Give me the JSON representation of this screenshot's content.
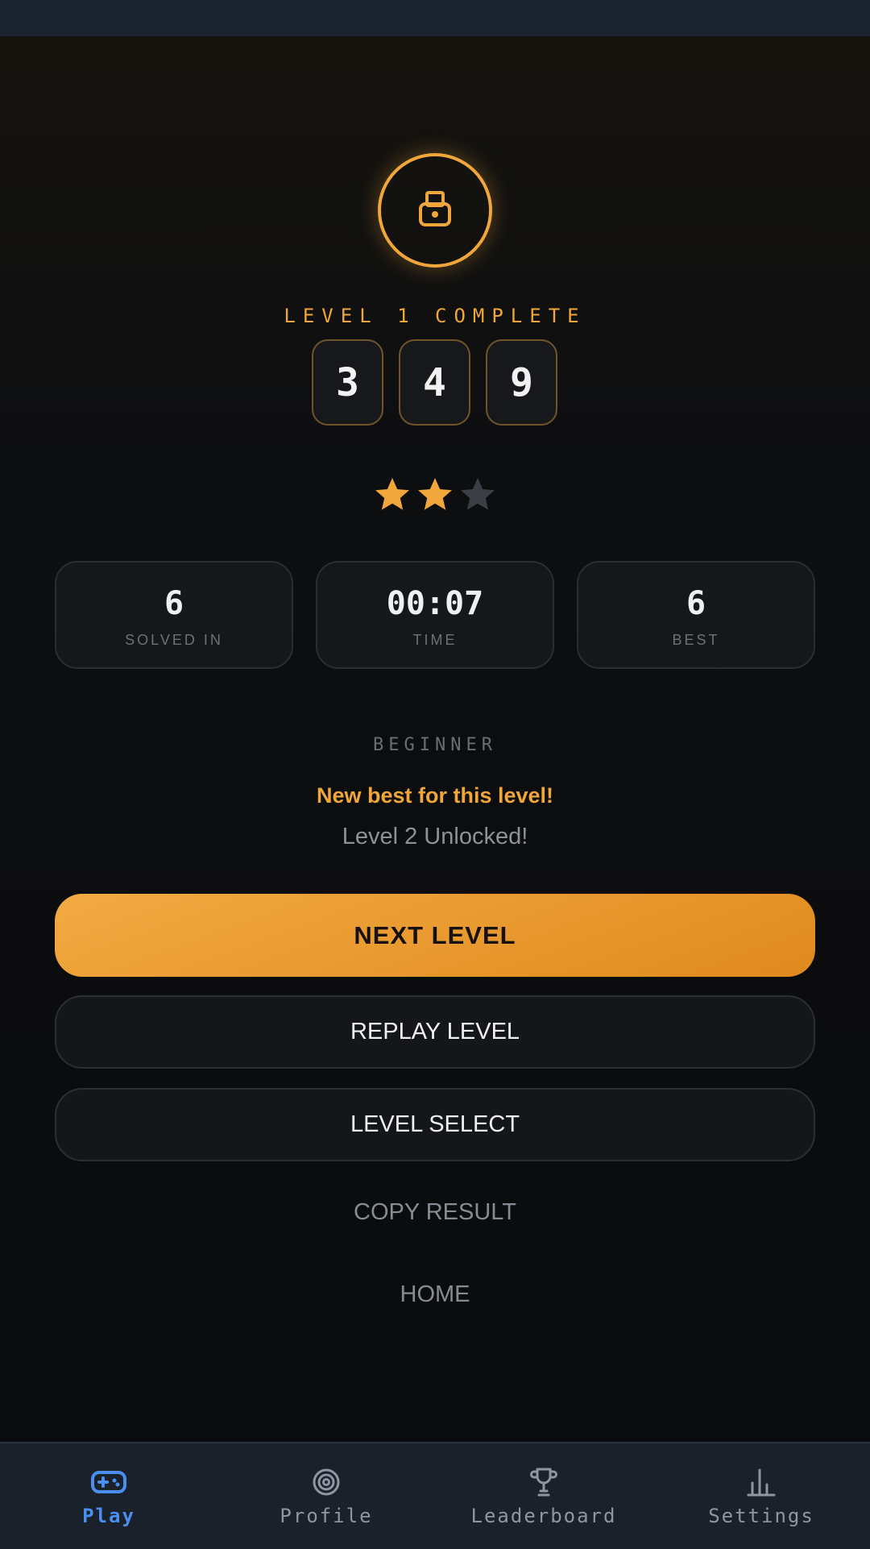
{
  "result": {
    "heading": "LEVEL 1 COMPLETE",
    "digits": [
      "3",
      "4",
      "9"
    ],
    "stars_earned": 2,
    "stars_total": 3,
    "colors": {
      "accent": "#f0a63a",
      "star_empty": "#3a3f46"
    }
  },
  "stats": [
    {
      "value": "6",
      "label": "SOLVED IN"
    },
    {
      "value": "00:07",
      "label": "TIME"
    },
    {
      "value": "6",
      "label": "BEST"
    }
  ],
  "difficulty": "BEGINNER",
  "messages": {
    "new_best": "New best for this level!",
    "unlocked": "Level 2 Unlocked!"
  },
  "actions": {
    "next_level": "NEXT LEVEL",
    "replay_level": "REPLAY LEVEL",
    "level_select": "LEVEL SELECT",
    "copy_result": "COPY RESULT",
    "home": "HOME"
  },
  "tabbar": {
    "active": "Play",
    "items": [
      {
        "label": "Play",
        "icon": "gamepad-icon"
      },
      {
        "label": "Profile",
        "icon": "target-icon"
      },
      {
        "label": "Leaderboard",
        "icon": "trophy-icon"
      },
      {
        "label": "Settings",
        "icon": "bar-chart-icon"
      }
    ],
    "colors": {
      "active": "#4a8ff0",
      "inactive": "#8d96a2"
    }
  }
}
